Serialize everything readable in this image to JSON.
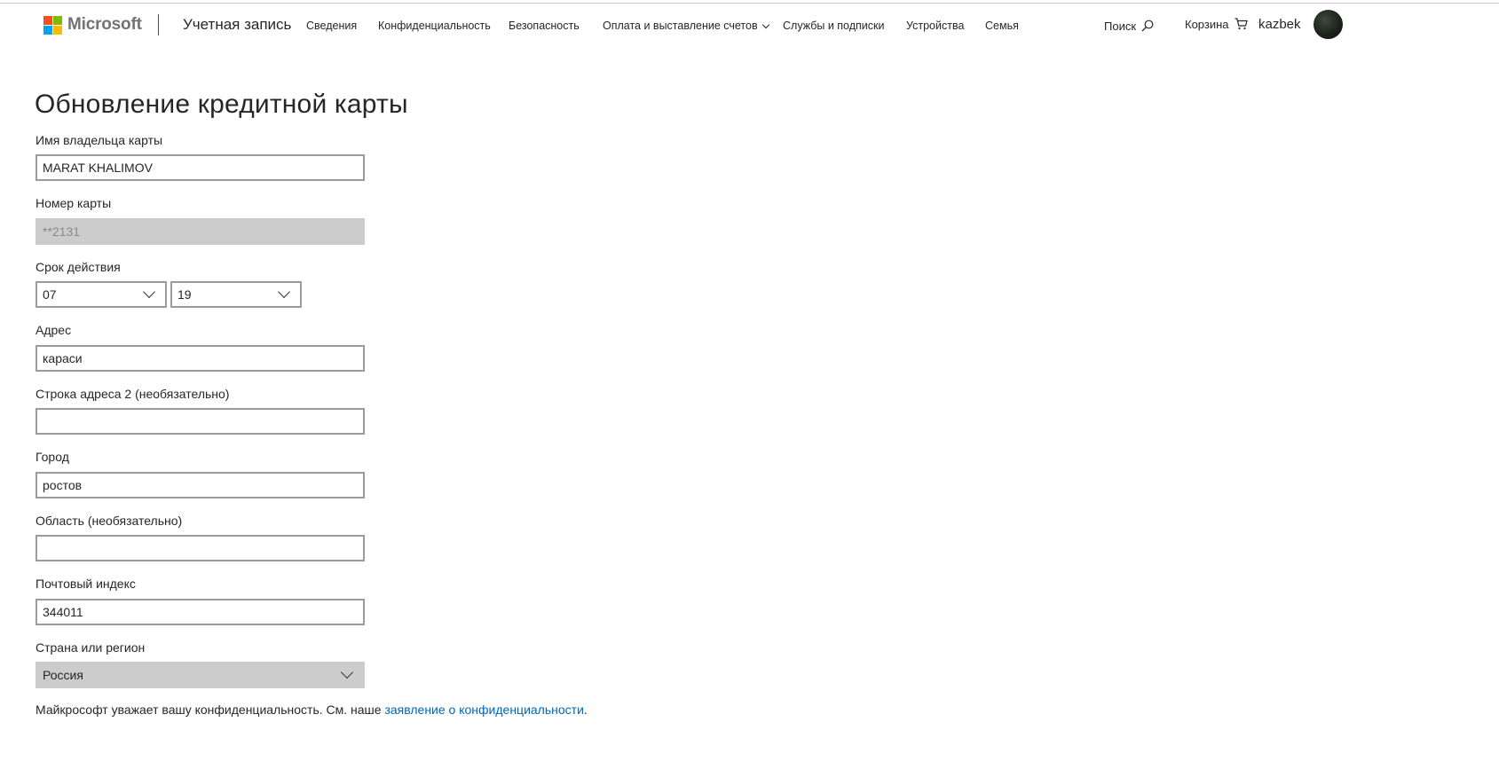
{
  "header": {
    "brand": "Microsoft",
    "logo_colors": [
      "#f25022",
      "#7fba00",
      "#00a4ef",
      "#ffb900"
    ],
    "account_title": "Учетная запись",
    "nav": [
      "Сведения",
      "Конфиденциальность",
      "Безопасность",
      "Оплата и выставление счетов",
      "Службы и подписки",
      "Устройства",
      "Семья"
    ],
    "search_label": "Поиск",
    "search_icon": "search-icon",
    "cart_label": "Корзина",
    "cart_icon": "cart-icon",
    "username": "kazbek"
  },
  "form": {
    "title": "Обновление кредитной карты",
    "cardholder_label": "Имя владельца карты",
    "cardholder_value": "MARAT KHALIMOV",
    "card_number_label": "Номер карты",
    "card_number_value": "**2131",
    "expiry_label": "Срок действия",
    "expiry_month": "07",
    "expiry_year": "19",
    "address_label": "Адрес",
    "address_value": "караси",
    "address2_label": "Строка адреса 2 (необязательно)",
    "address2_value": "",
    "city_label": "Город",
    "city_value": "ростов",
    "region_label": "Область (необязательно)",
    "region_value": "",
    "postal_label": "Почтовый индекс",
    "postal_value": "344011",
    "country_label": "Страна или регион",
    "country_value": "Россия"
  },
  "footer": {
    "privacy_text": "Майкрософт уважает вашу конфиденциальность. См. наше ",
    "privacy_link": "заявление о конфиденциальности",
    "privacy_end": "."
  },
  "colors": {
    "link": "#0067b8",
    "disabled_bg": "#cccccc"
  }
}
